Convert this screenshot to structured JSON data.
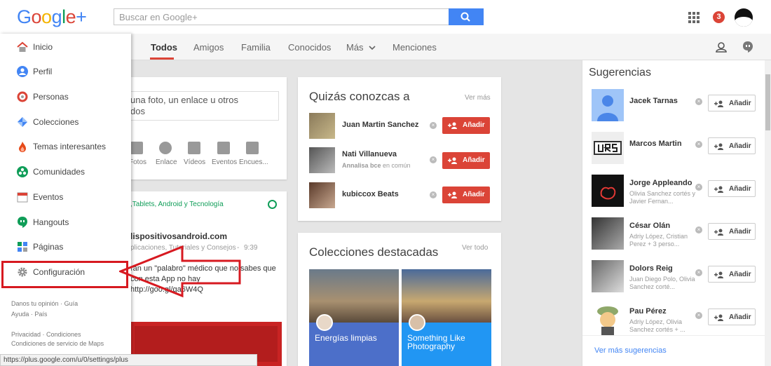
{
  "header": {
    "logo": "Google+",
    "search_placeholder": "Buscar en Google+",
    "notification_count": "3"
  },
  "nav": {
    "tabs": [
      "Todos",
      "Amigos",
      "Familia",
      "Conocidos",
      "Más",
      "Menciones"
    ]
  },
  "drawer": {
    "items": [
      {
        "label": "Inicio"
      },
      {
        "label": "Perfil"
      },
      {
        "label": "Personas"
      },
      {
        "label": "Colecciones"
      },
      {
        "label": "Temas interesantes"
      },
      {
        "label": "Comunidades"
      },
      {
        "label": "Eventos"
      },
      {
        "label": "Hangouts"
      },
      {
        "label": "Páginas"
      },
      {
        "label": "Configuración"
      }
    ],
    "footer": {
      "feedback": "Danos tu opinión",
      "guide": "Guía",
      "help": "Ayuda",
      "country": "País",
      "privacy": "Privacidad",
      "conditions": "Condiciones",
      "maps_terms": "Condiciones de servicio de Maps"
    }
  },
  "share_box": {
    "prompt": "una foto, un enlace u otros",
    "prompt_line2": "dos",
    "actions": [
      "Fotos",
      "Enlace",
      "Vídeos",
      "Eventos",
      "Encues..."
    ]
  },
  "post": {
    "community": ",Tablets, Android y Tecnología",
    "author": "lispositivosandroid.com",
    "meta": "plicaciones, Tutoriales y Consejos",
    "time": "9:39",
    "text_line1": "ran un \"palabro\" médico que no sabes que",
    "text_line2": "con esta App no hay",
    "text_line3": "http://goo.gl/ga6W4Q"
  },
  "people_card": {
    "title": "Quizás conozcas a",
    "see_more": "Ver más",
    "add_label": "Añadir",
    "people": [
      {
        "name": "Juan Martin Sanchez",
        "sub": ""
      },
      {
        "name": "Nati Villanueva",
        "sub_bold": "Annalisa bce",
        "sub": " en común"
      },
      {
        "name": "kubiccox Beats",
        "sub": ""
      }
    ]
  },
  "collections_card": {
    "title": "Colecciones destacadas",
    "see_all": "Ver todo",
    "items": [
      {
        "label": "Energías limpias",
        "color": "#4c6fc9"
      },
      {
        "label": "Something Like Photography",
        "color": "#2196f3"
      }
    ]
  },
  "suggestions": {
    "title": "Sugerencias",
    "add_label": "Añadir",
    "see_more": "Ver más sugerencias",
    "people": [
      {
        "name": "Jacek Tarnas",
        "sub": ""
      },
      {
        "name": "Marcos Martin",
        "sub": ""
      },
      {
        "name": "Jorge Appleando",
        "sub": "Olivia Sanchez cortés y Javier Fernan..."
      },
      {
        "name": "César Olán",
        "sub": "Adriy López, Cristian Perez + 3 perso..."
      },
      {
        "name": "Dolors Reig",
        "sub": "Juan Diego Polo, Olivia Sanchez corté..."
      },
      {
        "name": "Pau Pérez",
        "sub": "Adriy López, Olivia Sanchez cortés + ..."
      }
    ]
  },
  "status_url": "https://plus.google.com/u/0/settings/plus",
  "colors": {
    "brand_red": "#db4437",
    "brand_blue": "#4285f4",
    "highlight": "#d71920"
  }
}
